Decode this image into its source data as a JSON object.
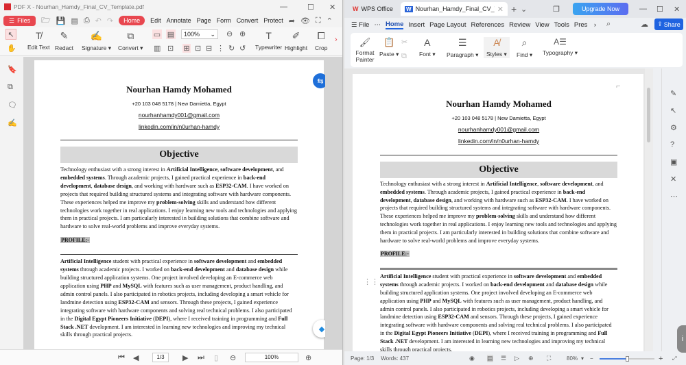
{
  "left": {
    "title": "PDF X - Nourhan_Hamdy_Final_CV_Template.pdf",
    "files_label": "Files",
    "menu": [
      "Home",
      "Edit",
      "Annotate",
      "Page",
      "Form",
      "Convert",
      "Protect"
    ],
    "tools": [
      "Edit Text",
      "Redact",
      "Signature",
      "Convert",
      "Typewriter",
      "Highlight",
      "Crop"
    ],
    "zoom_select": "100%",
    "page_input": "1/3",
    "bottom_zoom": "100%"
  },
  "right": {
    "tab_app": "WPS Office",
    "tab_doc": "Nourhan_Hamdy_Final_CV_Te",
    "upgrade": "Upgrade Now",
    "file": "File",
    "menu": [
      "Home",
      "Insert",
      "Page Layout",
      "References",
      "Review",
      "View",
      "Tools",
      "Pres"
    ],
    "share": "Share",
    "ribbon": [
      "Format Painter",
      "Paste",
      "Font",
      "Paragraph",
      "Styles",
      "Find",
      "Typography"
    ],
    "status_page": "Page: 1/3",
    "status_words": "Words: 437",
    "zoom": "80%"
  },
  "doc": {
    "name": "Nourhan Hamdy Mohamed",
    "contact": "+20 103 048 5178 | New Damietta, Egypt",
    "email": "nourhanhamdy001@gmail.com",
    "linkedin": "linkedin.com/in/n0urhan-hamdy",
    "objective_title": "Objective",
    "objective": [
      [
        "Technology enthusiast with a strong interest in ",
        0
      ],
      [
        "Artificial Intelligence",
        1
      ],
      [
        ", ",
        0
      ],
      [
        "software development",
        1
      ],
      [
        ", and ",
        0
      ],
      [
        "embedded systems",
        1
      ],
      [
        ". Through academic projects, I gained practical experience in ",
        0
      ],
      [
        "back-end development",
        1
      ],
      [
        ", ",
        0
      ],
      [
        "database design",
        1
      ],
      [
        ", and working with hardware such as ",
        0
      ],
      [
        "ESP32-CAM",
        1
      ],
      [
        ". I have worked on projects that required building structured systems and integrating software with hardware components. These experiences helped me improve my ",
        0
      ],
      [
        "problem-solving",
        1
      ],
      [
        " skills and understand how different technologies work together in real applications. I enjoy learning new tools and technologies and applying them in practical projects. I am particularly interested in building solutions that combine software and hardware to solve real-world problems and improve everyday systems.",
        0
      ]
    ],
    "profile_title": "PROFILE:-",
    "profile": [
      [
        "Artificial Intelligence",
        1
      ],
      [
        " student with practical experience in ",
        0
      ],
      [
        "software development",
        1
      ],
      [
        " and ",
        0
      ],
      [
        "embedded systems",
        1
      ],
      [
        " through academic projects. I worked on ",
        0
      ],
      [
        "back-end development",
        1
      ],
      [
        " and ",
        0
      ],
      [
        "database design",
        1
      ],
      [
        " while building structured application systems. One project involved developing an E-commerce web application using ",
        0
      ],
      [
        "PHP",
        1
      ],
      [
        " and ",
        0
      ],
      [
        "MySQL",
        1
      ],
      [
        " with features such as user management, product handling, and admin control panels. I also participated in robotics projects, including developing a smart vehicle for landmine detection using ",
        0
      ],
      [
        "ESP32-CAM",
        1
      ],
      [
        " and sensors. Through these projects, I gained experience integrating software with hardware components and solving real technical problems. I also participated in the ",
        0
      ],
      [
        "Digital Egypt Pioneers Initiative",
        1
      ],
      [
        " (",
        0
      ],
      [
        "DEPI",
        1
      ],
      [
        "), where I received training in programming and ",
        0
      ],
      [
        "Full Stack .NET",
        1
      ],
      [
        " development. I am interested in learning new technologies and improving my technical skills through practical projects.",
        0
      ]
    ]
  },
  "colors": {
    "pdfx_red": "#e8474f",
    "wps_blue": "#1f63e0",
    "upgrade": "#5b6cf0"
  }
}
